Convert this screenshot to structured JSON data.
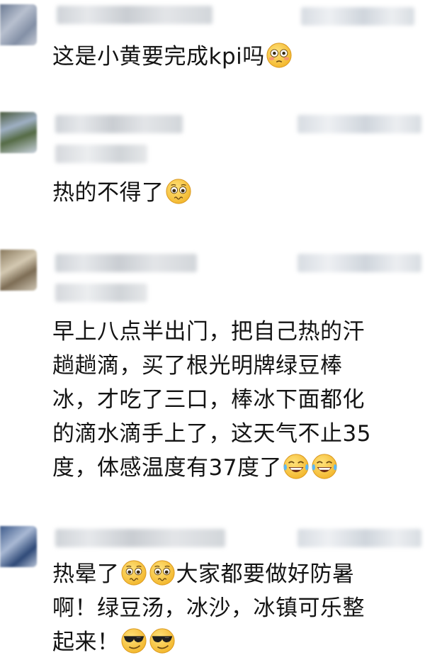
{
  "comments": [
    {
      "text": "这是小黄要完成kpi吗",
      "emojis": [
        "flushed-face-icon"
      ]
    },
    {
      "text": "热的不得了",
      "emojis": [
        "pleading-face-icon"
      ]
    },
    {
      "lines": [
        "早上八点半出门，把自己热的汗",
        "趟趟滴，买了根光明牌绿豆棒",
        "冰，才吃了三口，棒冰下面都化",
        "的滴水滴手上了，这天气不止35",
        "度，体感温度有37度了"
      ],
      "emojis": [
        "tears-of-joy-icon",
        "tears-of-joy-icon"
      ]
    },
    {
      "line1_before": "热晕了",
      "line1_after": "大家都要做好防暑",
      "line2": "啊！绿豆汤，冰沙，冰镇可乐整",
      "line3": "起来！",
      "emojis_line1": [
        "pleading-face-icon",
        "pleading-face-icon"
      ],
      "emojis_line3": [
        "sunglasses-face-icon",
        "sunglasses-face-icon"
      ]
    }
  ],
  "colors": {
    "text": "#141414",
    "emoji_yellow": "#f7c33a",
    "background": "#ffffff"
  }
}
